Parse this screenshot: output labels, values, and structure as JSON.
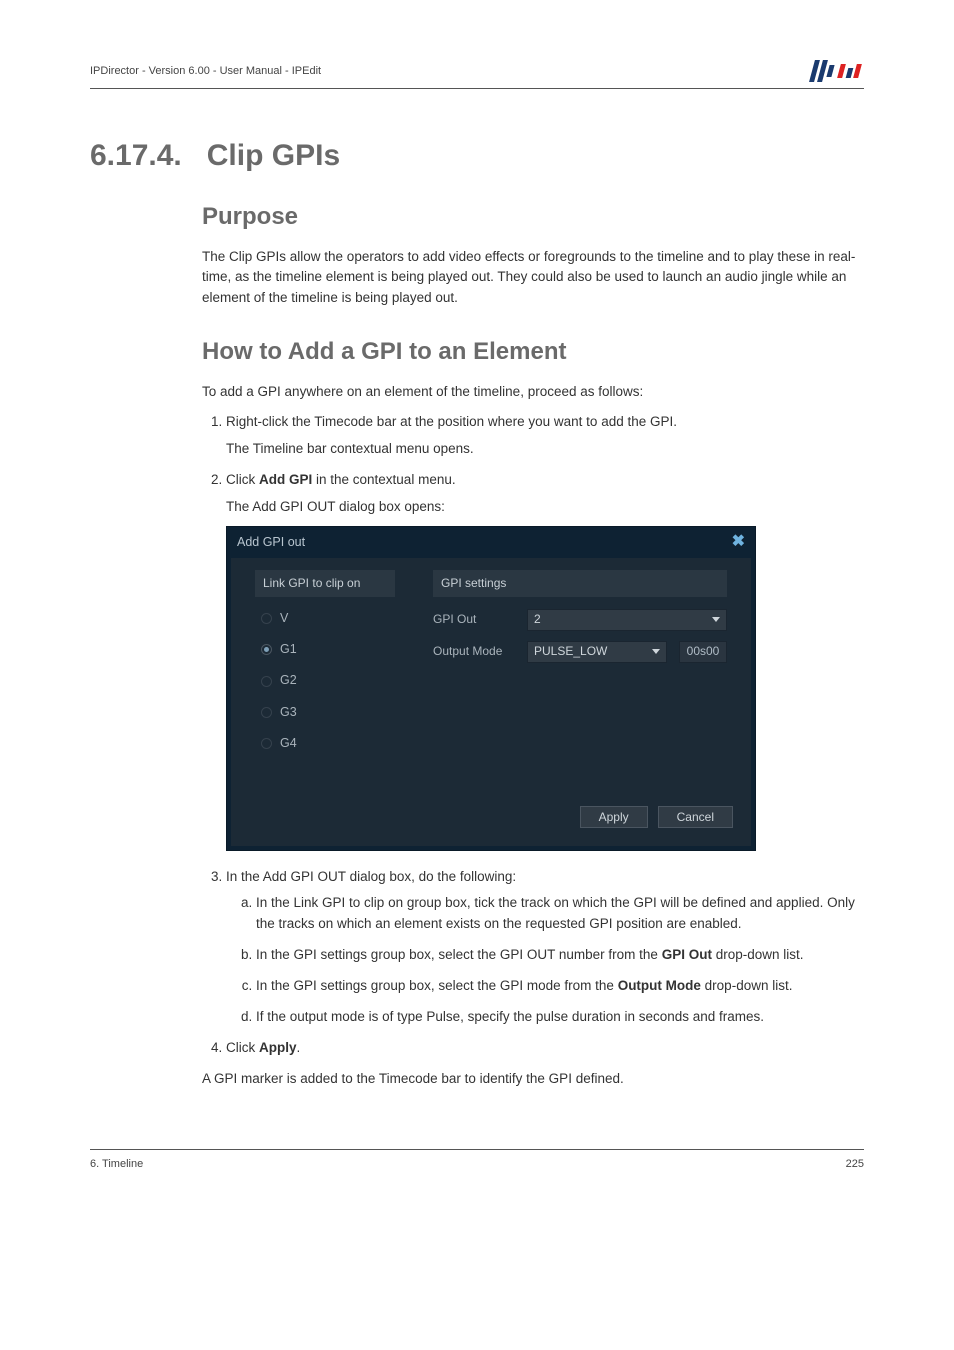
{
  "header": {
    "text": "IPDirector - Version 6.00 - User Manual - IPEdit"
  },
  "section": {
    "number": "6.17.4.",
    "title": "Clip GPIs"
  },
  "purpose": {
    "heading": "Purpose",
    "para": "The Clip GPIs allow the operators to add video effects or foregrounds to the timeline and to play these in real-time, as the timeline element is being played out. They could also be used to launch an audio jingle while an element of the timeline is being played out."
  },
  "howto": {
    "heading": "How to Add a GPI to an Element",
    "intro": "To add a GPI anywhere on an element of the timeline, proceed as follows:",
    "steps": {
      "s1": "Right-click the Timecode bar at the position where you want to add the GPI.",
      "s1b": "The Timeline bar contextual menu opens.",
      "s2a": "Click ",
      "s2bold": "Add GPI",
      "s2b": " in the contextual menu.",
      "s2c": "The Add GPI OUT dialog box opens:",
      "s3": "In the Add GPI OUT dialog box, do the following:",
      "s3a": "In the Link GPI to clip on group box, tick the track on which the GPI will be defined and applied. Only the tracks on which an element exists on the requested GPI position are enabled.",
      "s3b_a": "In the GPI settings group box, select the GPI OUT number from the ",
      "s3b_bold": "GPI Out",
      "s3b_b": " drop-down list.",
      "s3c_a": "In the GPI settings group box, select the GPI mode from the ",
      "s3c_bold": "Output Mode",
      "s3c_b": " drop-down list.",
      "s3d": "If the output mode is of type Pulse, specify the pulse duration in seconds and frames.",
      "s4a": "Click ",
      "s4bold": "Apply",
      "s4b": "."
    },
    "outro": "A GPI marker is added to the Timecode bar to identify the GPI defined."
  },
  "dialog": {
    "title": "Add GPI out",
    "left_group": "Link GPI to clip on",
    "right_group": "GPI settings",
    "tracks": [
      "V",
      "G1",
      "G2",
      "G3",
      "G4"
    ],
    "selected_track_index": 1,
    "gpi_out_label": "GPI Out",
    "gpi_out_value": "2",
    "output_mode_label": "Output Mode",
    "output_mode_value": "PULSE_LOW",
    "pulse_value": "00s00",
    "apply": "Apply",
    "cancel": "Cancel"
  },
  "footer": {
    "left": "6. Timeline",
    "right": "225"
  }
}
